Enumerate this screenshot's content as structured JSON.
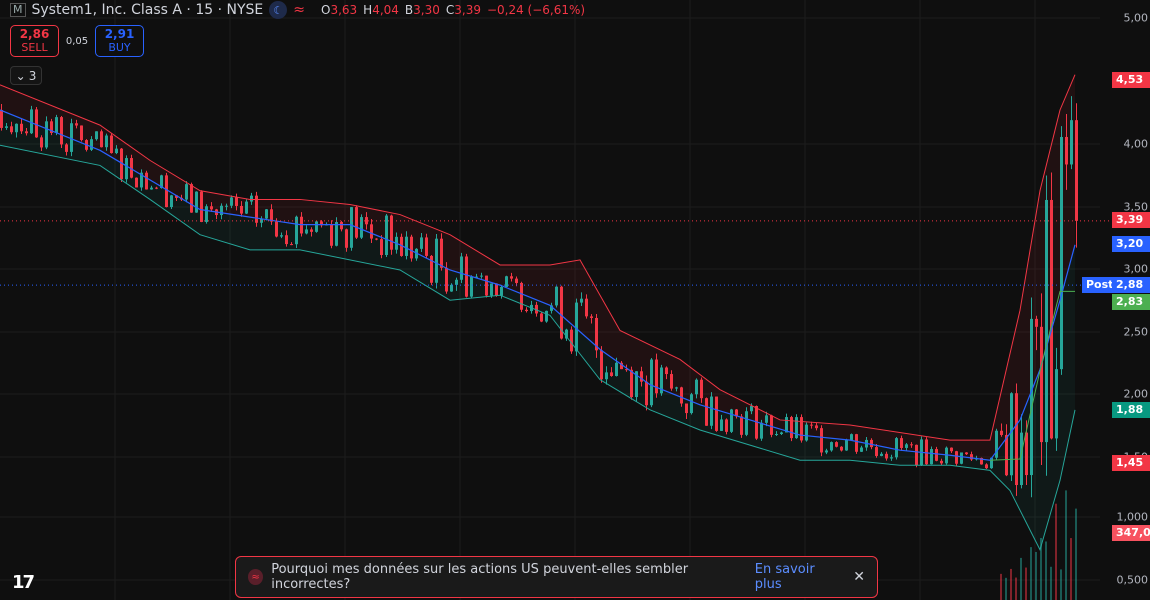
{
  "header": {
    "title": "System1, Inc. Class A · 15 · NYSE",
    "logo": "M",
    "moon_icon": "moon-icon",
    "wave_icon": "wave-icon",
    "ohlc": {
      "o_label": "O",
      "o": "3,63",
      "h_label": "H",
      "h": "4,04",
      "b_label": "B",
      "b": "3,30",
      "c_label": "C",
      "c": "3,39",
      "change": "−0,24 (−6,61%)"
    }
  },
  "trade": {
    "sell_price": "2,86",
    "sell_label": "SELL",
    "spread": "0,05",
    "buy_price": "2,91",
    "buy_label": "BUY"
  },
  "indicators_collapsed": {
    "count": "3"
  },
  "price_axis": {
    "ticks": [
      "5,00",
      "4,00",
      "3,50",
      "3,00",
      "2,50",
      "2,00",
      "1,50"
    ],
    "volume_ticks": [
      "1,000",
      "0,500"
    ]
  },
  "tags": {
    "high": "4,53",
    "last": "3,39",
    "ma": "3,20",
    "post_label": "Post",
    "post": "2,88",
    "stair": "2,83",
    "lower": "1,88",
    "low": "1,45",
    "volume": "347,0"
  },
  "colors": {
    "up": "#26a69a",
    "down": "#f23645",
    "ma": "#2962ff",
    "upper_band": "#f23645",
    "lower_band": "#26a69a",
    "stair": "#4caf50",
    "background": "#0f0f0f"
  },
  "banner": {
    "text": "Pourquoi mes données sur les actions US peuvent-elles sembler incorrectes?",
    "link": "En savoir plus",
    "close_icon": "close-icon"
  },
  "chart_data": {
    "type": "candlestick",
    "x_unit": "bar index",
    "ma": [
      [
        0,
        4.27
      ],
      [
        20,
        3.95
      ],
      [
        40,
        3.48
      ],
      [
        60,
        3.36
      ],
      [
        70,
        3.36
      ],
      [
        80,
        3.2
      ],
      [
        90,
        3.0
      ],
      [
        100,
        2.88
      ],
      [
        110,
        2.72
      ],
      [
        120,
        2.37
      ],
      [
        130,
        2.09
      ],
      [
        140,
        1.93
      ],
      [
        150,
        1.81
      ],
      [
        160,
        1.69
      ],
      [
        170,
        1.65
      ],
      [
        180,
        1.57
      ],
      [
        190,
        1.53
      ],
      [
        198,
        1.49
      ],
      [
        204,
        1.81
      ],
      [
        208,
        2.21
      ],
      [
        212,
        2.76
      ],
      [
        215,
        3.2
      ]
    ],
    "upper": [
      [
        0,
        4.47
      ],
      [
        20,
        4.15
      ],
      [
        30,
        3.87
      ],
      [
        40,
        3.63
      ],
      [
        50,
        3.56
      ],
      [
        60,
        3.56
      ],
      [
        70,
        3.52
      ],
      [
        80,
        3.44
      ],
      [
        90,
        3.28
      ],
      [
        100,
        3.04
      ],
      [
        110,
        3.04
      ],
      [
        116,
        3.08
      ],
      [
        124,
        2.52
      ],
      [
        136,
        2.29
      ],
      [
        144,
        2.05
      ],
      [
        156,
        1.81
      ],
      [
        170,
        1.77
      ],
      [
        190,
        1.65
      ],
      [
        198,
        1.65
      ],
      [
        204,
        2.68
      ],
      [
        208,
        3.63
      ],
      [
        212,
        4.27
      ],
      [
        215,
        4.55
      ]
    ],
    "lower": [
      [
        0,
        3.99
      ],
      [
        20,
        3.83
      ],
      [
        30,
        3.56
      ],
      [
        40,
        3.28
      ],
      [
        50,
        3.16
      ],
      [
        60,
        3.16
      ],
      [
        80,
        3.0
      ],
      [
        90,
        2.76
      ],
      [
        100,
        2.8
      ],
      [
        110,
        2.64
      ],
      [
        120,
        2.13
      ],
      [
        130,
        1.89
      ],
      [
        140,
        1.73
      ],
      [
        150,
        1.61
      ],
      [
        160,
        1.49
      ],
      [
        170,
        1.49
      ],
      [
        180,
        1.45
      ],
      [
        190,
        1.45
      ],
      [
        198,
        1.41
      ],
      [
        202,
        1.25
      ],
      [
        208,
        0.78
      ],
      [
        212,
        1.33
      ],
      [
        215,
        1.89
      ]
    ],
    "stair": [
      [
        198,
        1.49
      ],
      [
        204,
        1.5
      ],
      [
        208,
        2.2
      ],
      [
        212,
        2.83
      ],
      [
        215,
        2.83
      ]
    ],
    "last_price": 3.39,
    "post_price": 2.88,
    "y_range": [
      0.35,
      5.1
    ]
  }
}
